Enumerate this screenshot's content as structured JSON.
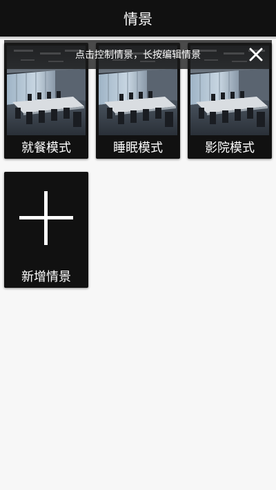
{
  "app_bar": {
    "title": "情景"
  },
  "hint": {
    "text": "点击控制情景，长按编辑情景",
    "close_icon": "close-icon"
  },
  "scenes": [
    {
      "label": "就餐模式",
      "image": "conference-room-image"
    },
    {
      "label": "睡眠模式",
      "image": "conference-room-image"
    },
    {
      "label": "影院模式",
      "image": "conference-room-image"
    }
  ],
  "add_scene": {
    "label": "新增情景",
    "icon": "plus-icon"
  },
  "colors": {
    "bar": "#111111",
    "card": "#111111",
    "background": "#f7f7f7",
    "text": "#ffffff"
  }
}
